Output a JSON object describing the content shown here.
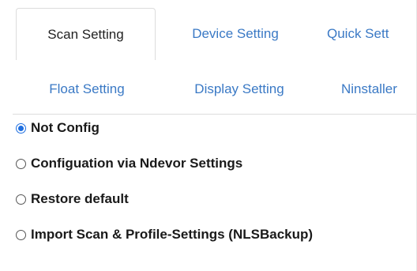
{
  "tabs_row1": [
    {
      "label": "Scan Setting",
      "active": true
    },
    {
      "label": "Device Setting",
      "active": false
    },
    {
      "label": "Quick Sett",
      "active": false
    }
  ],
  "tabs_row2": [
    {
      "label": "Float Setting",
      "active": false
    },
    {
      "label": "Display Setting",
      "active": false
    },
    {
      "label": "Ninstaller",
      "active": false
    }
  ],
  "options": [
    {
      "label": "Not Config",
      "checked": true
    },
    {
      "label": "Configuation via Ndevor Settings",
      "checked": false
    },
    {
      "label": "Restore default",
      "checked": false
    },
    {
      "label": "Import Scan & Profile-Settings (NLSBackup)",
      "checked": false
    }
  ],
  "colors": {
    "tab_link": "#3a79c5",
    "radio_selected": "#1f6fe0"
  }
}
